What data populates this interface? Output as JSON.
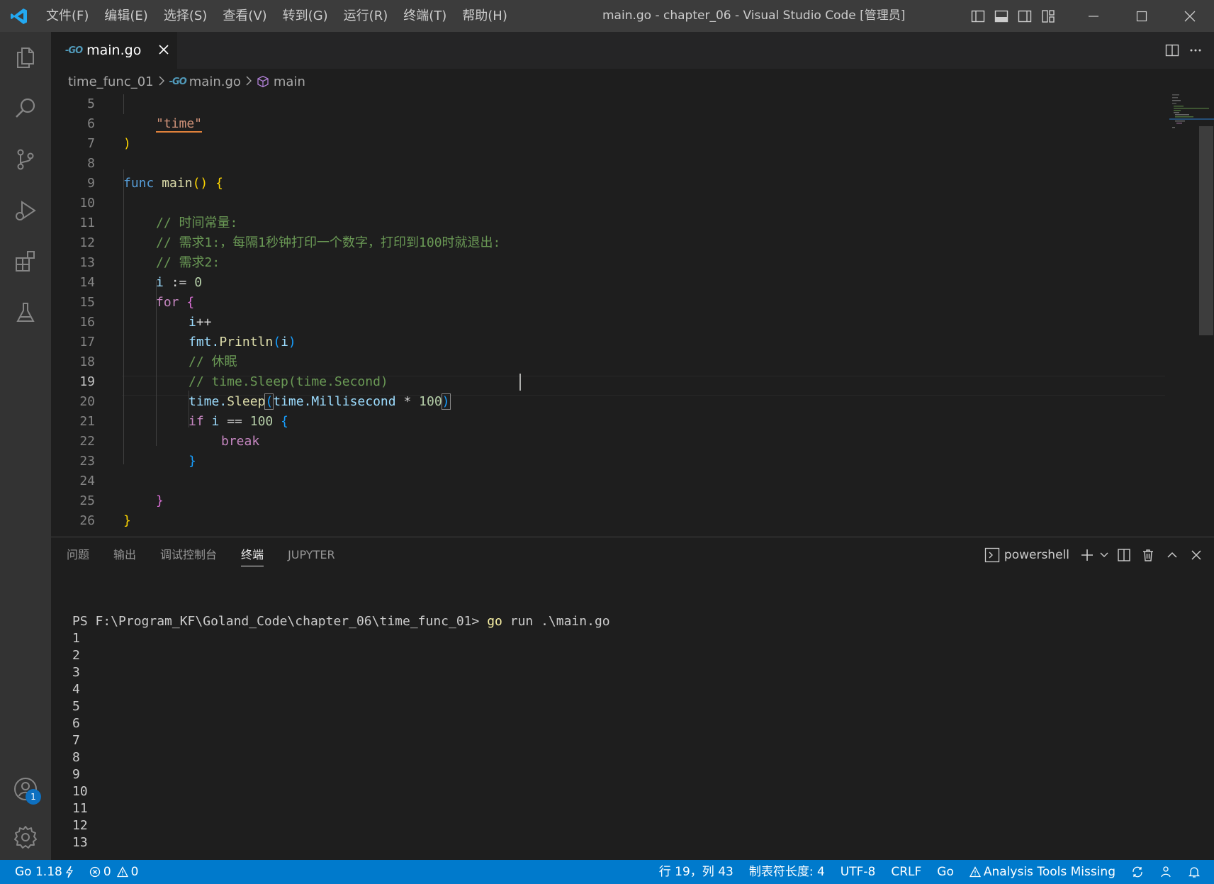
{
  "titlebar": {
    "menu": [
      "文件(F)",
      "编辑(E)",
      "选择(S)",
      "查看(V)",
      "转到(G)",
      "运行(R)",
      "终端(T)",
      "帮助(H)"
    ],
    "window_title": "main.go - chapter_06 - Visual Studio Code [管理员]"
  },
  "activity": {
    "account_badge": "1"
  },
  "tab": {
    "go_glyph": "-GO",
    "label": "main.go"
  },
  "breadcrumb": {
    "folder": "time_func_01",
    "file": "main.go",
    "symbol": "main",
    "go_glyph": "-GO"
  },
  "editor": {
    "line_numbers": [
      "5",
      "6",
      "7",
      "8",
      "9",
      "10",
      "11",
      "12",
      "13",
      "14",
      "15",
      "16",
      "17",
      "18",
      "19",
      "20",
      "21",
      "22",
      "23",
      "24",
      "25",
      "26"
    ],
    "active_line": "19",
    "code": {
      "l5_str": "\"time\"",
      "l6_paren": ")",
      "l8_func": "func",
      "l8_name": "main",
      "l8_parens": "()",
      "l8_brace": "{",
      "l10_comment": "// 时间常量:",
      "l11_comment": "// 需求1:，每隔1秒钟打印一个数字，打印到100时就退出:",
      "l12_comment": "// 需求2:",
      "l13_var": "i",
      "l13_op": ":=",
      "l13_num": "0",
      "l14_for": "for",
      "l14_brace": "{",
      "l15_var": "i",
      "l15_op": "++",
      "l16_pkg": "fmt.",
      "l16_fn": "Println",
      "l16_open": "(",
      "l16_arg": "i",
      "l16_close": ")",
      "l17_comment": "// 休眠",
      "l18_comment": "// time.Sleep(time.Second)",
      "l19_pkg": "time.",
      "l19_fn": "Sleep",
      "l19_open": "(",
      "l19_arg": "time.Millisecond",
      "l19_op": "*",
      "l19_num": "100",
      "l19_close": ")",
      "l20_if": "if",
      "l20_var": "i",
      "l20_op": "==",
      "l20_num": "100",
      "l20_brace": "{",
      "l21_break": "break",
      "l22_brace": "}",
      "l24_brace": "}",
      "l25_brace": "}"
    }
  },
  "panel": {
    "tabs": [
      "问题",
      "输出",
      "调试控制台",
      "终端",
      "JUPYTER"
    ],
    "active_tab": "终端",
    "shell": "powershell",
    "prompt": "PS F:\\Program_KF\\Goland_Code\\chapter_06\\time_func_01>",
    "command_go": "go",
    "command_rest": "run .\\main.go",
    "output": [
      "1",
      "2",
      "3",
      "4",
      "5",
      "6",
      "7",
      "8",
      "9",
      "10",
      "11",
      "12",
      "13"
    ]
  },
  "statusbar": {
    "go_version": "Go 1.18",
    "errors": "0",
    "warnings": "0",
    "position": "行 19，列 43",
    "tab_size": "制表符长度: 4",
    "encoding": "UTF-8",
    "eol": "CRLF",
    "language": "Go",
    "analysis": "Analysis Tools Missing"
  },
  "colors": {
    "statusbar": "#007acc",
    "titlebar": "#3c3c3c",
    "activitybar": "#333333",
    "editor_bg": "#1e1e1e",
    "accent_blue": "#0e70c0"
  }
}
